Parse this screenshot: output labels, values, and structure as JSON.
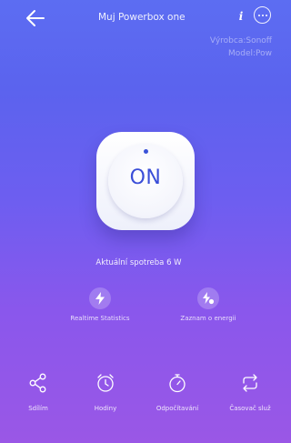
{
  "header": {
    "back_icon": "arrow-left-icon",
    "title": "Muj Powerbox one",
    "info_icon": "info-icon",
    "more_icon": "more-dots-icon"
  },
  "device": {
    "manufacturer": "Výrobca:Sonoff",
    "model": "Model:Pow"
  },
  "power_button": {
    "label": "ON",
    "state": "on"
  },
  "consumption_text": "Aktuální spotreba 6 W",
  "features": [
    {
      "label": "Realtime Statistics",
      "icon": "lightning-icon"
    },
    {
      "label": "Zaznam o energii",
      "icon": "energy-record-icon"
    }
  ],
  "bottom_tabs": [
    {
      "label": "Sdílím",
      "icon": "share-icon"
    },
    {
      "label": "Hodiny",
      "icon": "alarm-clock-icon"
    },
    {
      "label": "Odpočítavání",
      "icon": "stopwatch-icon"
    },
    {
      "label": "Časovač služ",
      "icon": "loop-icon"
    }
  ],
  "colors": {
    "accent": "#3a4ed8",
    "background_top": "#5c6df2",
    "background_bottom": "#9a57e6"
  }
}
